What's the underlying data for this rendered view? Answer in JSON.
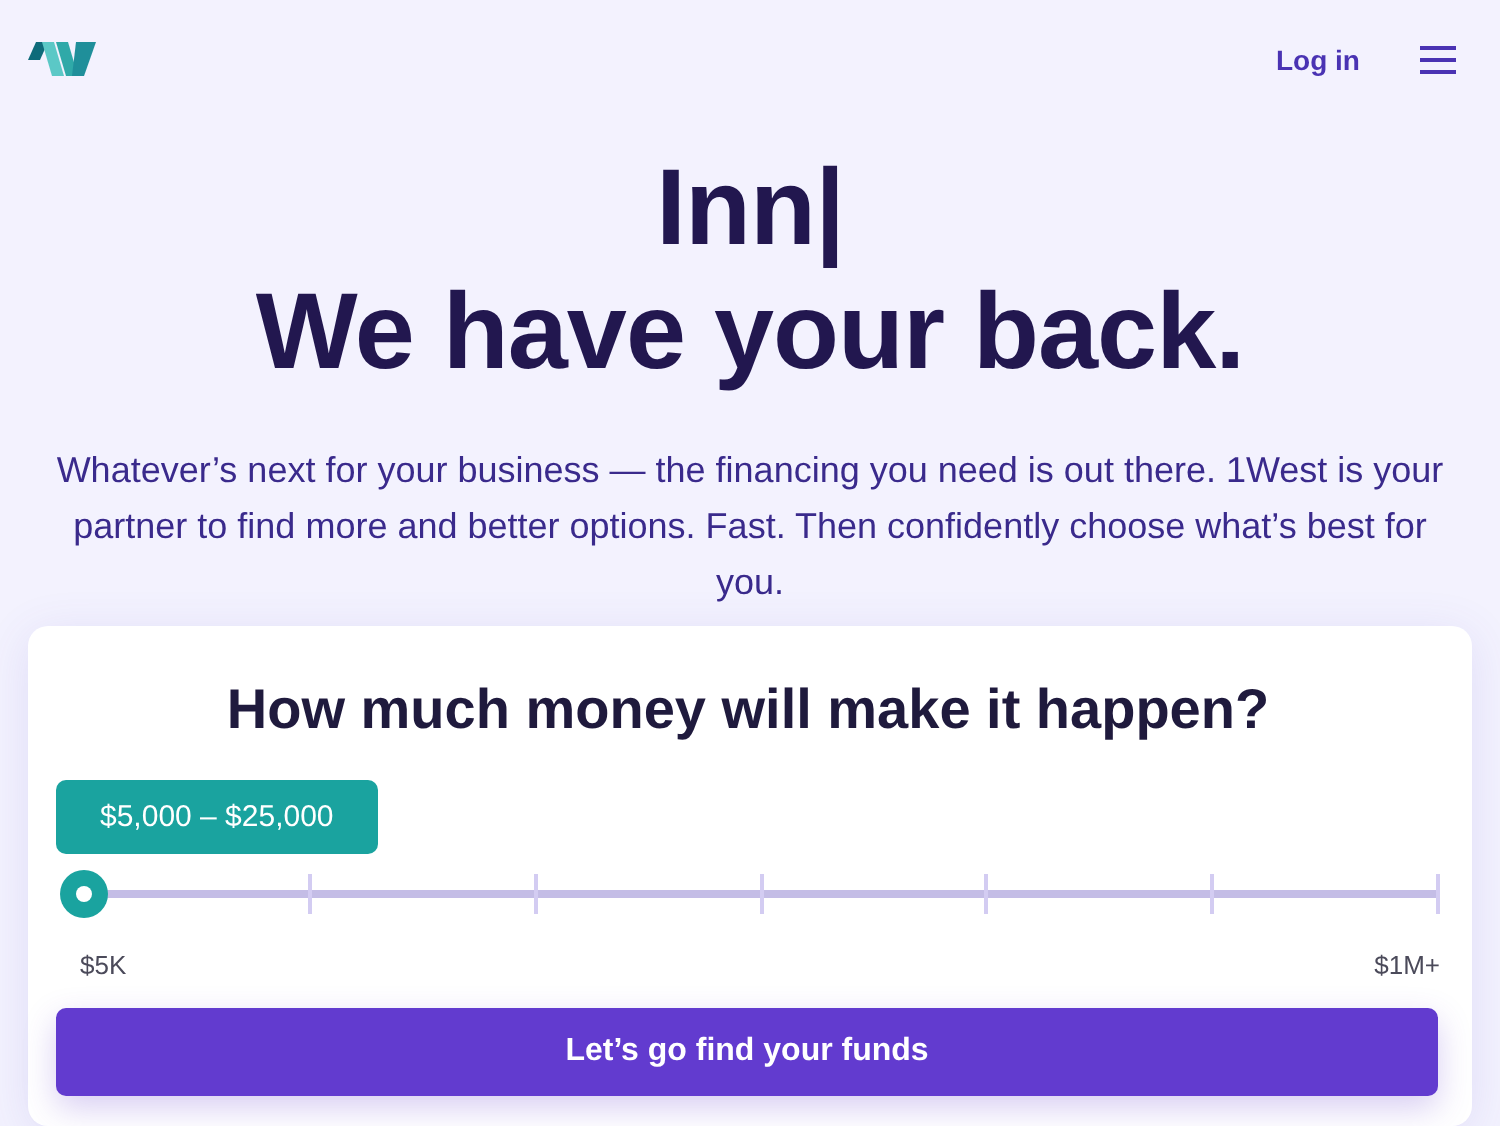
{
  "header": {
    "login": "Log in"
  },
  "hero": {
    "typed": "Inn",
    "cursor": "|",
    "headline": "We have your back.",
    "description": "Whatever’s next for your business — the financing you need is out there. 1West is your partner to find more and better options. Fast. Then confidently choose what’s best for you."
  },
  "card": {
    "title": "How much money will make it happen?",
    "slider": {
      "tooltip": "$5,000 – $25,000",
      "min_label": "$5K",
      "max_label": "$1M+"
    },
    "button": "Let’s go find your funds"
  }
}
